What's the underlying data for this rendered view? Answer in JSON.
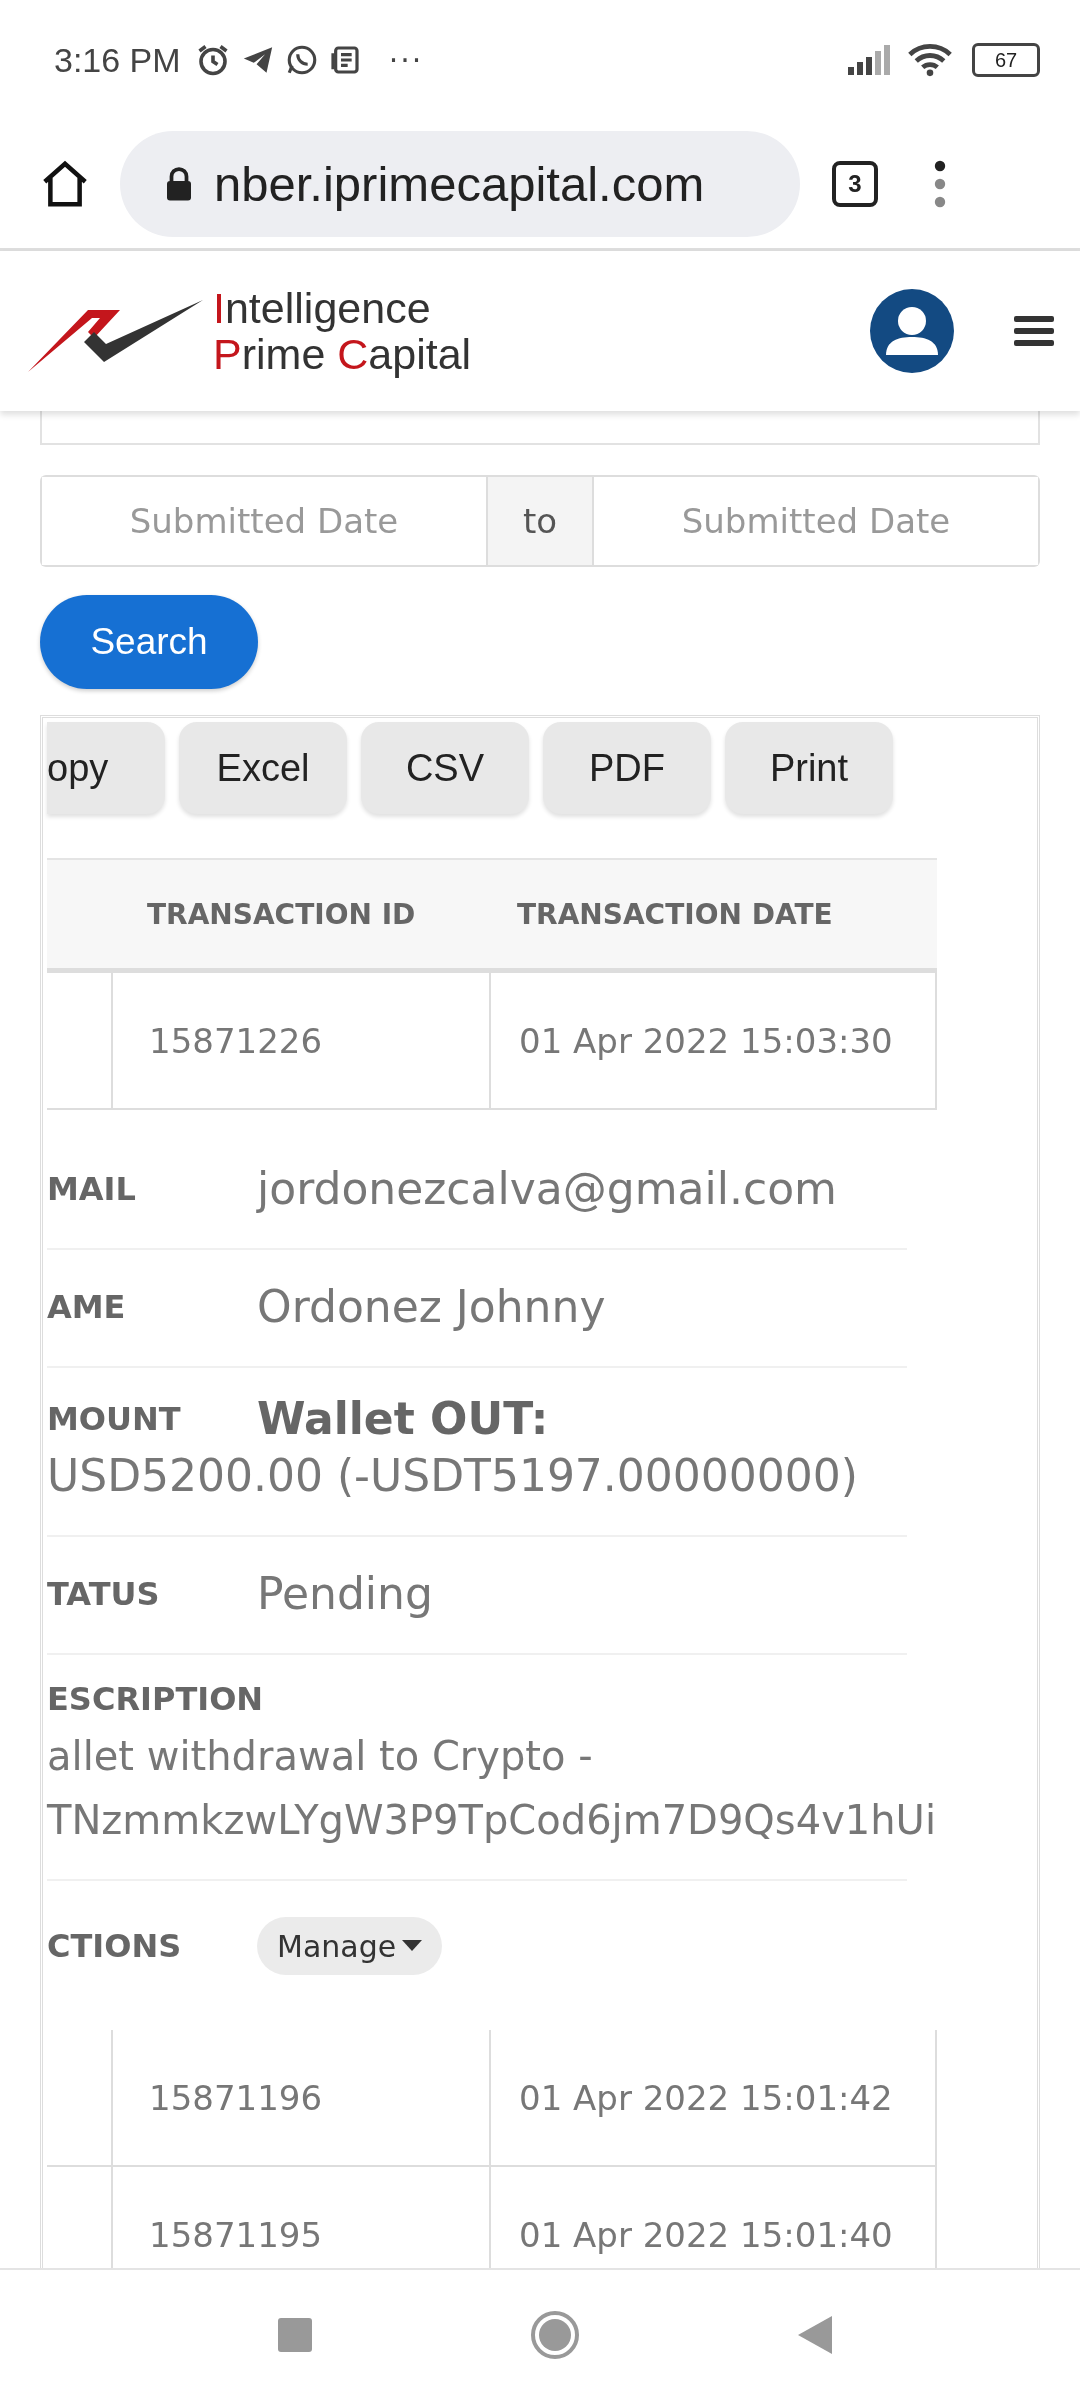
{
  "status_bar": {
    "time": "3:16 PM",
    "more": "···",
    "battery": "67"
  },
  "browser": {
    "url": "nber.iprimecapital.com",
    "tab_count": "3"
  },
  "site": {
    "brand_lines": [
      [
        {
          "text": "I",
          "accent": true
        },
        {
          "text": "ntelligence",
          "accent": false
        }
      ],
      [
        {
          "text": "P",
          "accent": true
        },
        {
          "text": "rime ",
          "accent": false
        },
        {
          "text": "C",
          "accent": true
        },
        {
          "text": "apital",
          "accent": false
        }
      ]
    ]
  },
  "filters": {
    "date_from": {
      "placeholder": "Submitted Date"
    },
    "separator": "to",
    "date_to": {
      "placeholder": "Submitted Date"
    },
    "search_button": "Search"
  },
  "export_buttons": [
    "opy",
    "Excel",
    "CSV",
    "PDF",
    "Print"
  ],
  "table": {
    "columns": [
      "TRANSACTION ID",
      "TRANSACTION DATE"
    ],
    "rows": [
      {
        "id": "15871226",
        "date": "01 Apr 2022 15:03:30",
        "details": [
          {
            "kind": "inline",
            "label": "MAIL",
            "value": "jordonezcalva@gmail.com"
          },
          {
            "kind": "inline",
            "label": "AME",
            "value": "Ordonez Johnny"
          },
          {
            "kind": "amount",
            "label": "MOUNT",
            "heading": "Wallet OUT:",
            "value": "USD5200.00 (-USDT5197.00000000)"
          },
          {
            "kind": "inline",
            "label": "TATUS",
            "value": "Pending"
          },
          {
            "kind": "block",
            "label": "ESCRIPTION",
            "lines": [
              "allet withdrawal to Crypto -",
              "TNzmmkzwLYgW3P9TpCod6jm7D9Qs4v1hUi"
            ]
          },
          {
            "kind": "action",
            "label": "CTIONS",
            "button": "Manage"
          }
        ]
      },
      {
        "id": "15871196",
        "date": "01 Apr 2022 15:01:42"
      },
      {
        "id": "15871195",
        "date": "01 Apr 2022 15:01:40"
      }
    ]
  }
}
